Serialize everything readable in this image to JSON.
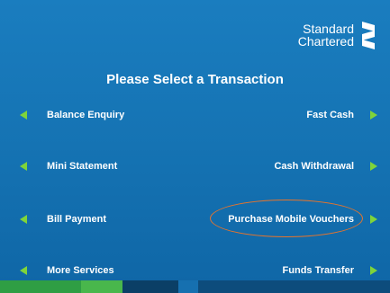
{
  "brand": {
    "line1": "Standard",
    "line2": "Chartered",
    "logo_icon": "standard-chartered-logo"
  },
  "title": "Please Select a Transaction",
  "options": {
    "left": [
      "Balance Enquiry",
      "Mini Statement",
      "Bill Payment",
      "More Services"
    ],
    "right": [
      "Fast Cash",
      "Cash Withdrawal",
      "Purchase Mobile Vouchers",
      "Funds Transfer"
    ]
  },
  "highlighted_option": "Purchase Mobile Vouchers",
  "colors": {
    "background": "#1573b3",
    "arrow": "#7fd43a",
    "highlight_ring": "#e8742b"
  }
}
